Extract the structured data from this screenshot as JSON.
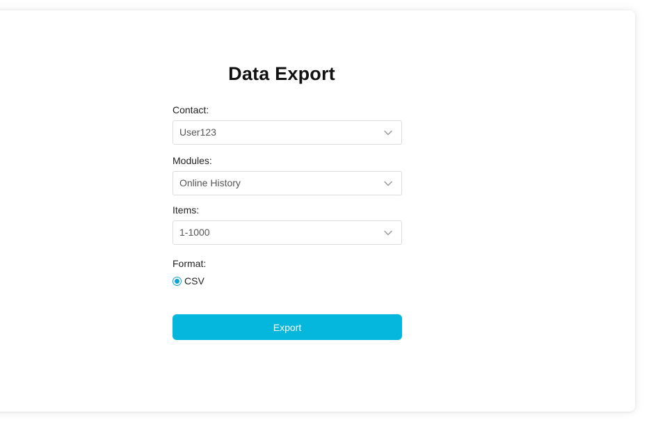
{
  "page": {
    "title": "Data Export"
  },
  "form": {
    "contact": {
      "label": "Contact:",
      "value": "User123"
    },
    "modules": {
      "label": "Modules:",
      "value": "Online History"
    },
    "items": {
      "label": "Items:",
      "value": "1-1000"
    },
    "format": {
      "label": "Format:",
      "options": [
        {
          "label": "CSV",
          "selected": true
        }
      ]
    }
  },
  "actions": {
    "export_label": "Export"
  },
  "colors": {
    "accent": "#05b7dc",
    "radio": "#0aa4d2"
  },
  "icons": {
    "dropdown": "chevron-down-icon"
  }
}
